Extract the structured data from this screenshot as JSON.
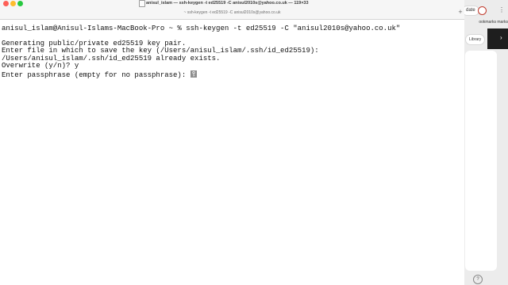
{
  "window": {
    "title": "anisul_islam — ssh-keygen -t ed25519 -C anisul2010s@yahoo.co.uk — 119×33",
    "tab_title": "~ ssh-keygen -t ed25519 -C anisul2010s@yahoo.co.uk",
    "new_tab_symbol": "+"
  },
  "terminal": {
    "lines": [
      "",
      "anisul_islam@Anisul-Islams-MacBook-Pro ~ % ssh-keygen -t ed25519 -C \"anisul2010s@yahoo.co.uk\"",
      "Generating public/private ed25519 key pair.",
      "Enter file in which to save the key (/Users/anisul_islam/.ssh/id_ed25519):",
      "/Users/anisul_islam/.ssh/id_ed25519 already exists.",
      "Overwrite (y/n)? y",
      "Enter passphrase (empty for no passphrase): "
    ]
  },
  "background_window": {
    "update_label": "date",
    "kebab": "⋮",
    "bookmarks_label": "ookmarks    marks",
    "library_label": "Library",
    "dark_caret": "›",
    "bottom_icon": "?"
  },
  "colors": {
    "close": "#fe5f57",
    "minimize": "#febc2e",
    "maximize": "#28c840",
    "terminal_bg": "#ffffff",
    "terminal_text": "#111111",
    "cursor": "#8e8e8e"
  }
}
